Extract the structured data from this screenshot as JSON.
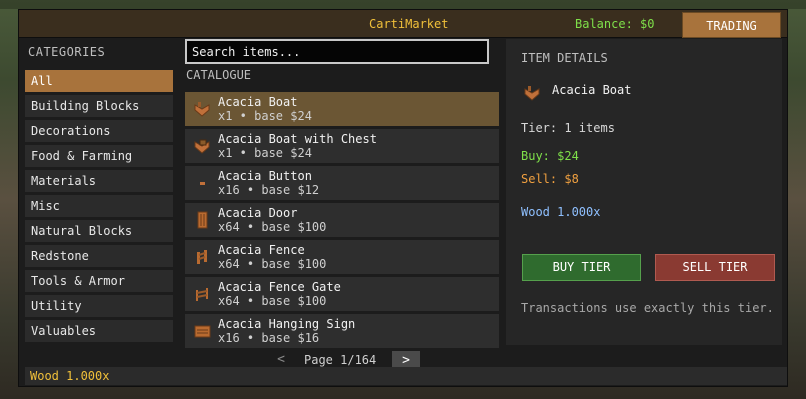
{
  "app": {
    "title": "CartiMarket",
    "balance": "Balance: $0",
    "mode": "TRADING"
  },
  "categories": {
    "heading": "CATEGORIES",
    "items": [
      {
        "label": "All",
        "active": true
      },
      {
        "label": "Building Blocks"
      },
      {
        "label": "Decorations"
      },
      {
        "label": "Food & Farming"
      },
      {
        "label": "Materials"
      },
      {
        "label": "Misc"
      },
      {
        "label": "Natural Blocks"
      },
      {
        "label": "Redstone"
      },
      {
        "label": "Tools & Armor"
      },
      {
        "label": "Utility"
      },
      {
        "label": "Valuables"
      }
    ]
  },
  "search": {
    "placeholder": "Search items..."
  },
  "catalogue": {
    "heading": "CATALOGUE",
    "items": [
      {
        "name": "Acacia Boat",
        "meta": "x1 • base $24",
        "icon": "boat-icon",
        "active": true
      },
      {
        "name": "Acacia Boat with Chest",
        "meta": "x1 • base $24",
        "icon": "boat-chest-icon"
      },
      {
        "name": "Acacia Button",
        "meta": "x16 • base $12",
        "icon": "button-icon"
      },
      {
        "name": "Acacia Door",
        "meta": "x64 • base $100",
        "icon": "door-icon"
      },
      {
        "name": "Acacia Fence",
        "meta": "x64 • base $100",
        "icon": "fence-icon"
      },
      {
        "name": "Acacia Fence Gate",
        "meta": "x64 • base $100",
        "icon": "fence-gate-icon"
      },
      {
        "name": "Acacia Hanging Sign",
        "meta": "x16 • base $16",
        "icon": "hanging-sign-icon"
      }
    ],
    "pager": {
      "prev": "<",
      "label": "Page 1/164",
      "next": ">"
    }
  },
  "details": {
    "heading": "ITEM DETAILS",
    "name": "Acacia Boat",
    "icon": "boat-icon",
    "tier": "Tier: 1 items",
    "buy": "Buy:  $24",
    "sell": "Sell:  $8",
    "wood": "Wood 1.000x",
    "buy_button": "BUY TIER",
    "sell_button": "SELL TIER",
    "note": "Transactions use exactly this tier."
  },
  "status": {
    "text": "Wood 1.000x"
  },
  "colors": {
    "accent": "#a8733c",
    "title": "#f0c03a",
    "balance": "#7fe04a",
    "buy": "#7fe04a",
    "sell": "#f0a040",
    "wood": "#8fc0ff"
  }
}
